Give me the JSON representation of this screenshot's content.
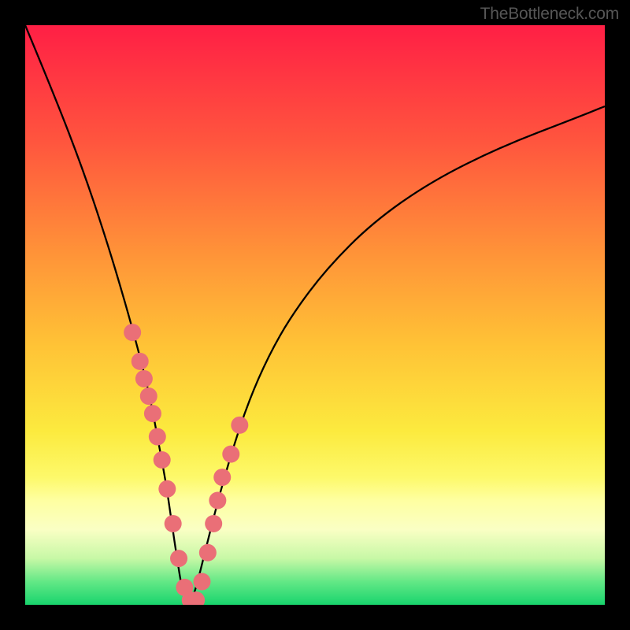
{
  "watermark": "TheBottleneck.com",
  "chart_data": {
    "type": "line",
    "title": "",
    "xlabel": "",
    "ylabel": "",
    "xlim": [
      0,
      100
    ],
    "ylim": [
      0,
      100
    ],
    "background": {
      "type": "vertical-gradient",
      "stops": [
        {
          "pos": 0.0,
          "color": "#ff1f45"
        },
        {
          "pos": 0.2,
          "color": "#ff553e"
        },
        {
          "pos": 0.4,
          "color": "#ff9538"
        },
        {
          "pos": 0.55,
          "color": "#ffc236"
        },
        {
          "pos": 0.7,
          "color": "#fcea3e"
        },
        {
          "pos": 0.78,
          "color": "#fdf96a"
        },
        {
          "pos": 0.82,
          "color": "#feffa1"
        },
        {
          "pos": 0.87,
          "color": "#faffc4"
        },
        {
          "pos": 0.92,
          "color": "#c7f8a6"
        },
        {
          "pos": 0.96,
          "color": "#63e886"
        },
        {
          "pos": 1.0,
          "color": "#18d46d"
        }
      ]
    },
    "series": [
      {
        "name": "bottleneck-curve",
        "x": [
          0,
          5,
          10,
          14,
          17,
          19.5,
          21.5,
          23,
          24.3,
          25.3,
          26.2,
          27,
          27.8,
          28.6,
          29.5,
          31,
          33,
          35.5,
          38.5,
          42,
          46,
          52,
          60,
          70,
          82,
          95,
          100
        ],
        "y": [
          100,
          88,
          75,
          63,
          53,
          44,
          36,
          28,
          21,
          14,
          8,
          3,
          0.5,
          0.5,
          3,
          9,
          17,
          26,
          35,
          43,
          50,
          58,
          66,
          73,
          79,
          84,
          86
        ]
      }
    ],
    "markers": {
      "name": "highlighted-points",
      "x": [
        18.5,
        19.8,
        20.5,
        21.3,
        22.0,
        22.8,
        23.6,
        24.5,
        25.5,
        26.5,
        27.5,
        28.5,
        29.5,
        30.5,
        31.5,
        32.5,
        33.2,
        34.0,
        35.5,
        37.0
      ],
      "y": [
        47,
        42,
        39,
        36,
        33,
        29,
        25,
        20,
        14,
        8,
        3,
        0.8,
        0.8,
        4,
        9,
        14,
        18,
        22,
        26,
        31
      ],
      "color": "#ea6f77",
      "radius": 11
    }
  }
}
